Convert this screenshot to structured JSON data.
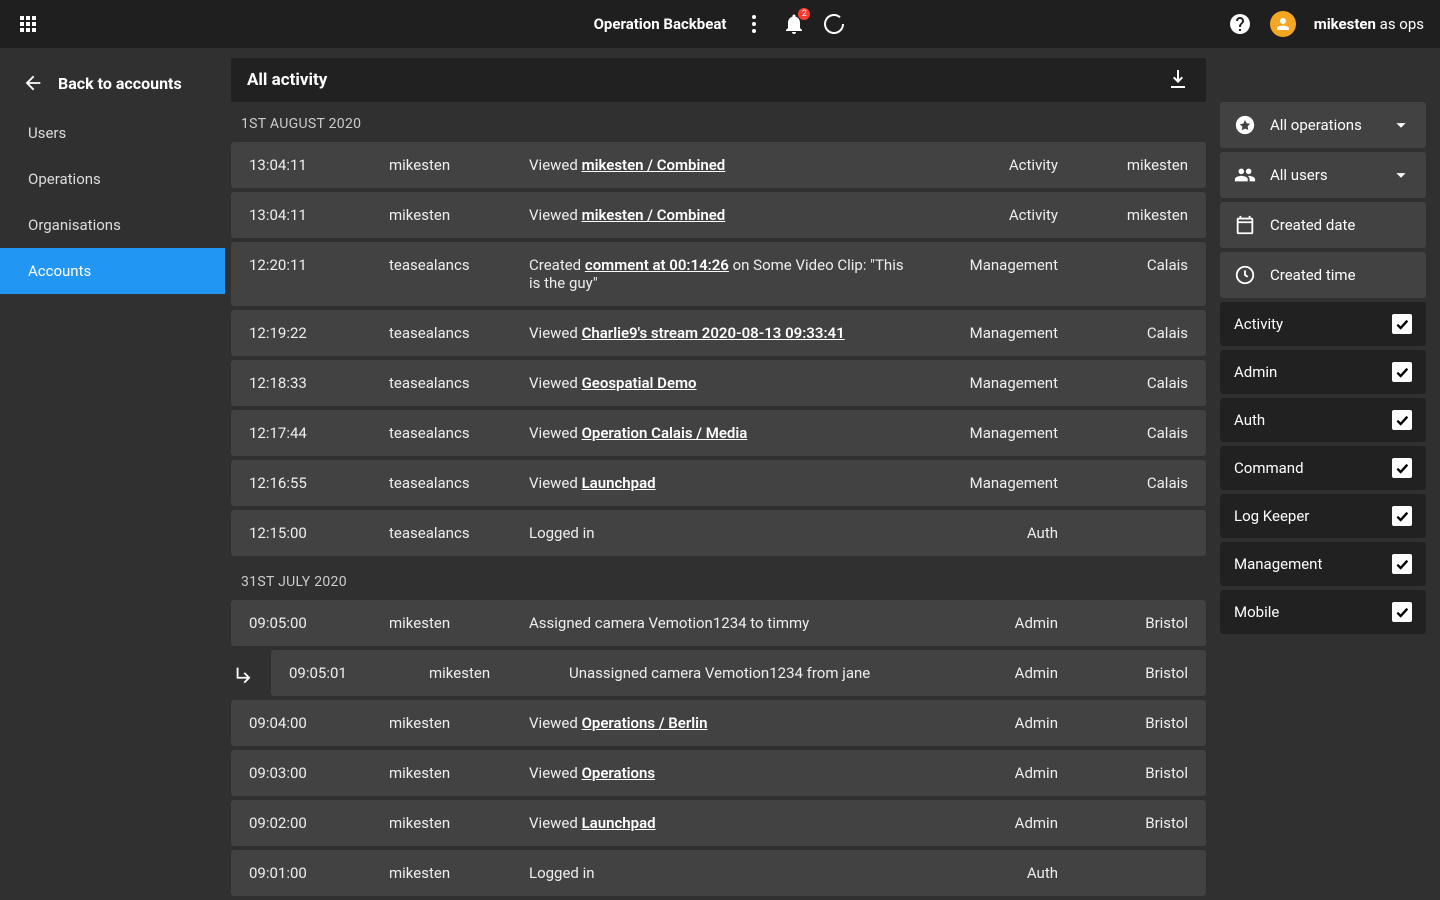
{
  "topbar": {
    "title": "Operation Backbeat",
    "notification_count": "2",
    "user": "mikesten",
    "user_suffix": " as ops"
  },
  "sidebar": {
    "back_label": "Back to accounts",
    "items": [
      {
        "label": "Users"
      },
      {
        "label": "Operations"
      },
      {
        "label": "Organisations"
      },
      {
        "label": "Accounts"
      }
    ],
    "active_index": 3
  },
  "activity": {
    "title": "All activity",
    "groups": [
      {
        "date": "1ST AUGUST 2020",
        "rows": [
          {
            "time": "13:04:11",
            "user": "mikesten",
            "action_prefix": "Viewed ",
            "action_link": "mikesten / Combined",
            "action_suffix": "",
            "type": "Activity",
            "location": "mikesten"
          },
          {
            "time": "13:04:11",
            "user": "mikesten",
            "action_prefix": "Viewed ",
            "action_link": "mikesten / Combined",
            "action_suffix": "",
            "type": "Activity",
            "location": "mikesten"
          },
          {
            "time": "12:20:11",
            "user": "teasealancs",
            "action_prefix": "Created ",
            "action_link": "comment at 00:14:26",
            "action_suffix": " on Some Video Clip: \"This is the guy\"",
            "type": "Management",
            "location": "Calais"
          },
          {
            "time": "12:19:22",
            "user": "teasealancs",
            "action_prefix": "Viewed ",
            "action_link": "Charlie9's stream 2020-08-13 09:33:41",
            "action_suffix": "",
            "type": "Management",
            "location": "Calais"
          },
          {
            "time": "12:18:33",
            "user": "teasealancs",
            "action_prefix": "Viewed ",
            "action_link": "Geospatial Demo",
            "action_suffix": "",
            "type": "Management",
            "location": "Calais"
          },
          {
            "time": "12:17:44",
            "user": "teasealancs",
            "action_prefix": "Viewed ",
            "action_link": "Operation Calais / Media",
            "action_suffix": "",
            "type": "Management",
            "location": "Calais"
          },
          {
            "time": "12:16:55",
            "user": "teasealancs",
            "action_prefix": "Viewed ",
            "action_link": "Launchpad",
            "action_suffix": "",
            "type": "Management",
            "location": "Calais"
          },
          {
            "time": "12:15:00",
            "user": "teasealancs",
            "action_prefix": "Logged in",
            "action_link": "",
            "action_suffix": "",
            "type": "Auth",
            "location": ""
          }
        ]
      },
      {
        "date": "31ST JULY 2020",
        "rows": [
          {
            "time": "09:05:00",
            "user": "mikesten",
            "action_prefix": "Assigned camera Vemotion1234 to timmy",
            "action_link": "",
            "action_suffix": "",
            "type": "Admin",
            "location": "Bristol"
          },
          {
            "sub": true,
            "time": "09:05:01",
            "user": "mikesten",
            "action_prefix": "Unassigned camera Vemotion1234 from jane",
            "action_link": "",
            "action_suffix": "",
            "type": "Admin",
            "location": "Bristol"
          },
          {
            "time": "09:04:00",
            "user": "mikesten",
            "action_prefix": "Viewed ",
            "action_link": "Operations / Berlin",
            "action_suffix": "",
            "type": "Admin",
            "location": "Bristol"
          },
          {
            "time": "09:03:00",
            "user": "mikesten",
            "action_prefix": "Viewed ",
            "action_link": "Operations",
            "action_suffix": "",
            "type": "Admin",
            "location": "Bristol"
          },
          {
            "time": "09:02:00",
            "user": "mikesten",
            "action_prefix": "Viewed ",
            "action_link": "Launchpad",
            "action_suffix": "",
            "type": "Admin",
            "location": "Bristol"
          },
          {
            "time": "09:01:00",
            "user": "mikesten",
            "action_prefix": "Logged in",
            "action_link": "",
            "action_suffix": "",
            "type": "Auth",
            "location": ""
          }
        ]
      }
    ]
  },
  "filters": {
    "dropdowns": [
      {
        "icon": "star",
        "label": "All operations"
      },
      {
        "icon": "group",
        "label": "All users"
      },
      {
        "icon": "calendar",
        "label": "Created date"
      },
      {
        "icon": "clock",
        "label": "Created time"
      }
    ],
    "checks": [
      {
        "label": "Activity",
        "checked": true
      },
      {
        "label": "Admin",
        "checked": true
      },
      {
        "label": "Auth",
        "checked": true
      },
      {
        "label": "Command",
        "checked": true
      },
      {
        "label": "Log Keeper",
        "checked": true
      },
      {
        "label": "Management",
        "checked": true
      },
      {
        "label": "Mobile",
        "checked": true
      }
    ]
  }
}
